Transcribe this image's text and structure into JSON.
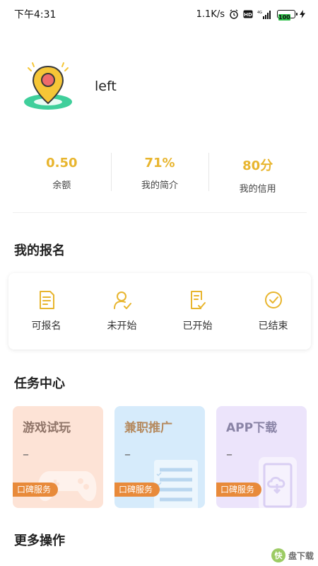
{
  "status_bar": {
    "time": "下午4:31",
    "network_speed": "1.1K/s",
    "battery_level": "100"
  },
  "profile": {
    "username": "left"
  },
  "stats": [
    {
      "value": "0.50",
      "label": "余额"
    },
    {
      "value": "71%",
      "label": "我的简介"
    },
    {
      "value": "80分",
      "label": "我的信用"
    }
  ],
  "my_signup": {
    "title": "我的报名",
    "items": [
      {
        "label": "可报名",
        "icon": "document-icon"
      },
      {
        "label": "未开始",
        "icon": "user-check-icon"
      },
      {
        "label": "已开始",
        "icon": "document-check-icon"
      },
      {
        "label": "已结束",
        "icon": "check-circle-icon"
      }
    ]
  },
  "task_center": {
    "title": "任务中心",
    "cards": [
      {
        "title": "游戏试玩",
        "dash": "–",
        "badge": "口碑服务",
        "icon": "gamepad-icon"
      },
      {
        "title": "兼职推广",
        "dash": "–",
        "badge": "口碑服务",
        "icon": "checklist-icon"
      },
      {
        "title": "APP下载",
        "dash": "–",
        "badge": "口碑服务",
        "icon": "phone-download-icon"
      }
    ]
  },
  "more_actions": {
    "title": "更多操作"
  },
  "watermark": {
    "char": "快",
    "text": "盘下载"
  },
  "colors": {
    "accent": "#e8b52e",
    "badge": "#e88a3a",
    "card_orange": "#fde3d6",
    "card_blue": "#d6ebfb",
    "card_purple": "#ece4fb"
  }
}
